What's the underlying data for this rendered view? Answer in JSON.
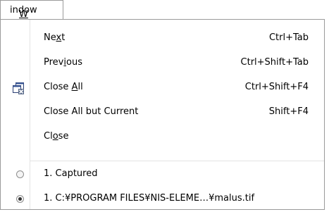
{
  "menubar": {
    "title": "Window"
  },
  "menu": {
    "items": [
      {
        "label": "Next",
        "shortcut": "Ctrl+Tab"
      },
      {
        "label": "Previous",
        "shortcut": "Ctrl+Shift+Tab"
      },
      {
        "label": "Close All",
        "shortcut": "Ctrl+Shift+F4",
        "icon": "close-all-windows-icon"
      },
      {
        "label": "Close All but Current",
        "shortcut": "Shift+F4"
      },
      {
        "label": "Close",
        "shortcut": ""
      }
    ],
    "windows": [
      {
        "label": "1. Captured",
        "selected": false
      },
      {
        "label": "1. C:¥PROGRAM FILES¥NIS-ELEME…¥malus.tif",
        "selected": true
      }
    ]
  }
}
